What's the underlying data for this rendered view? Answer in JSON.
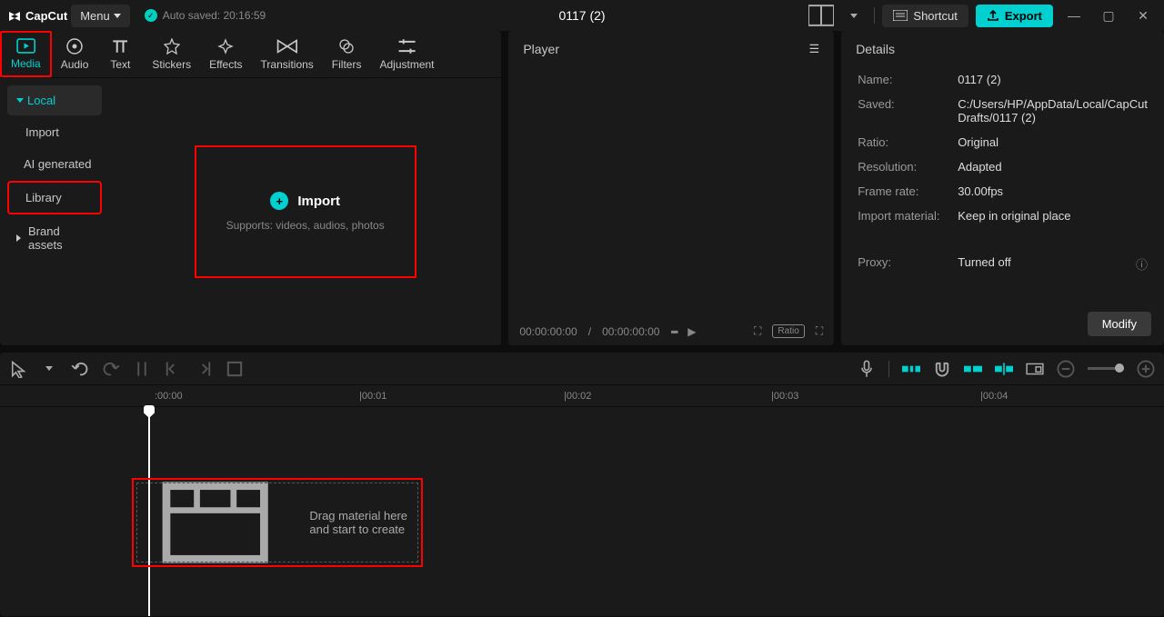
{
  "titlebar": {
    "logo": "CapCut",
    "menu": "Menu",
    "autosave": "Auto saved: 20:16:59",
    "project_name": "0117 (2)",
    "shortcut": "Shortcut",
    "export": "Export"
  },
  "tabs": {
    "media": "Media",
    "audio": "Audio",
    "text": "Text",
    "stickers": "Stickers",
    "effects": "Effects",
    "transitions": "Transitions",
    "filters": "Filters",
    "adjustment": "Adjustment"
  },
  "sidebar": {
    "local": "Local",
    "import": "Import",
    "ai_generated": "AI generated",
    "library": "Library",
    "brand_assets": "Brand assets"
  },
  "import": {
    "label": "Import",
    "sub": "Supports: videos, audios, photos"
  },
  "player": {
    "title": "Player",
    "current": "00:00:00:00",
    "separator": "/",
    "total": "00:00:00:00",
    "ratio": "Ratio"
  },
  "details": {
    "title": "Details",
    "name_label": "Name:",
    "name_value": "0117 (2)",
    "saved_label": "Saved:",
    "saved_value": "C:/Users/HP/AppData/Local/CapCut Drafts/0117 (2)",
    "ratio_label": "Ratio:",
    "ratio_value": "Original",
    "resolution_label": "Resolution:",
    "resolution_value": "Adapted",
    "framerate_label": "Frame rate:",
    "framerate_value": "30.00fps",
    "import_material_label": "Import material:",
    "import_material_value": "Keep in original place",
    "proxy_label": "Proxy:",
    "proxy_value": "Turned off",
    "modify": "Modify"
  },
  "timeline": {
    "marks": [
      ":00:00",
      "|00:01",
      "|00:02",
      "|00:03",
      "|00:04"
    ],
    "drop_message": "Drag material here and start to create"
  }
}
